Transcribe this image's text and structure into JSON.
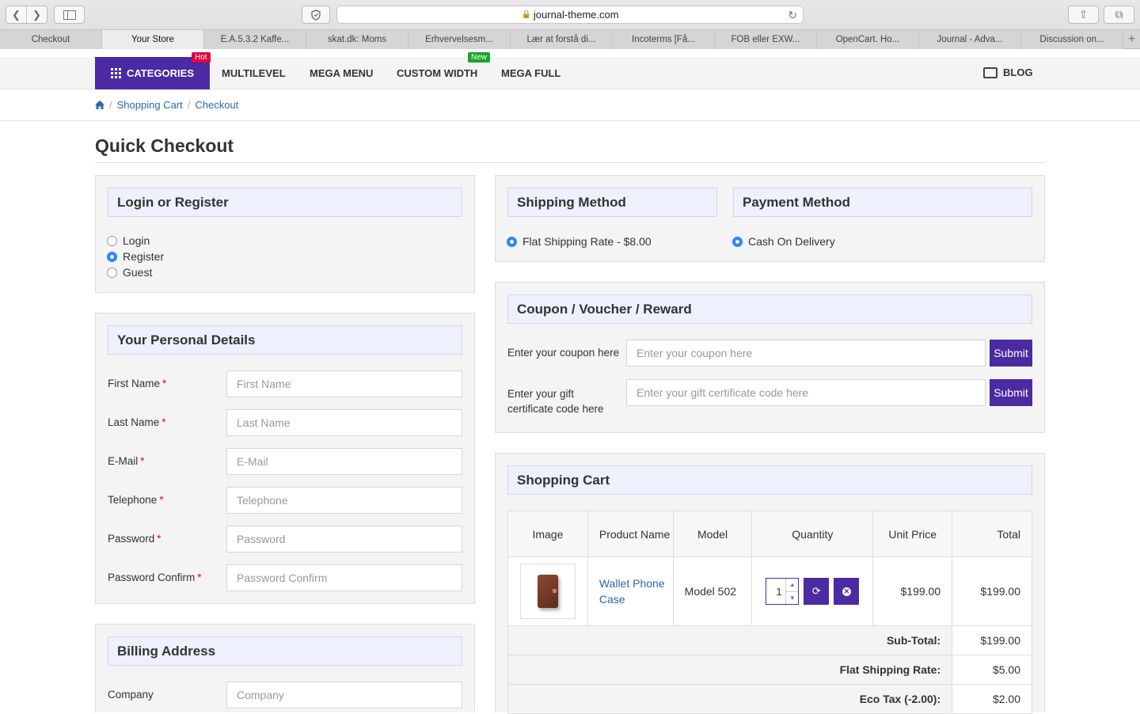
{
  "browser": {
    "url": "journal-theme.com",
    "tabs": [
      "Checkout",
      "Your Store",
      "E.A.5.3.2 Kaffe...",
      "skat.dk: Moms",
      "Erhvervelsesm...",
      "Lær at forstå di...",
      "Incoterms [Få...",
      "FOB eller EXW...",
      "OpenCart. Ho...",
      "Journal - Adva...",
      "Discussion on..."
    ],
    "new_tab": "+"
  },
  "menu": {
    "categories": "CATEGORIES",
    "hot": "Hot",
    "new": "New",
    "multilevel": "MULTILEVEL",
    "mega_menu": "MEGA MENU",
    "custom_width": "CUSTOM WIDTH",
    "mega_full": "MEGA FULL",
    "blog": "BLOG"
  },
  "breadcrumb": {
    "cart": "Shopping Cart",
    "checkout": "Checkout",
    "sep": "/"
  },
  "page_title": "Quick Checkout",
  "login": {
    "title": "Login or Register",
    "options": [
      "Login",
      "Register",
      "Guest"
    ],
    "selected": "Register"
  },
  "personal": {
    "title": "Your Personal Details",
    "fields": [
      {
        "label": "First Name",
        "placeholder": "First Name"
      },
      {
        "label": "Last Name",
        "placeholder": "Last Name"
      },
      {
        "label": "E-Mail",
        "placeholder": "E-Mail"
      },
      {
        "label": "Telephone",
        "placeholder": "Telephone"
      },
      {
        "label": "Password",
        "placeholder": "Password"
      },
      {
        "label": "Password Confirm",
        "placeholder": "Password Confirm"
      }
    ],
    "required": "*"
  },
  "billing": {
    "title": "Billing Address",
    "company_label": "Company",
    "company_placeholder": "Company"
  },
  "shipping": {
    "title": "Shipping Method",
    "option": "Flat Shipping Rate - $8.00"
  },
  "payment": {
    "title": "Payment Method",
    "option": "Cash On Delivery"
  },
  "coupon": {
    "title": "Coupon / Voucher / Reward",
    "coupon_label": "Enter your coupon here",
    "coupon_placeholder": "Enter your coupon here",
    "gift_label": "Enter your gift certificate code here",
    "gift_placeholder": "Enter your gift certificate code here",
    "submit": "Submit"
  },
  "cart": {
    "title": "Shopping Cart",
    "headers": {
      "image": "Image",
      "name": "Product Name",
      "model": "Model",
      "quantity": "Quantity",
      "unit": "Unit Price",
      "total": "Total"
    },
    "item": {
      "name": "Wallet Phone Case",
      "model": "Model 502",
      "qty": "1",
      "unit": "$199.00",
      "total": "$199.00"
    },
    "totals": [
      {
        "label": "Sub-Total:",
        "value": "$199.00"
      },
      {
        "label": "Flat Shipping Rate:",
        "value": "$5.00"
      },
      {
        "label": "Eco Tax (-2.00):",
        "value": "$2.00"
      }
    ]
  }
}
